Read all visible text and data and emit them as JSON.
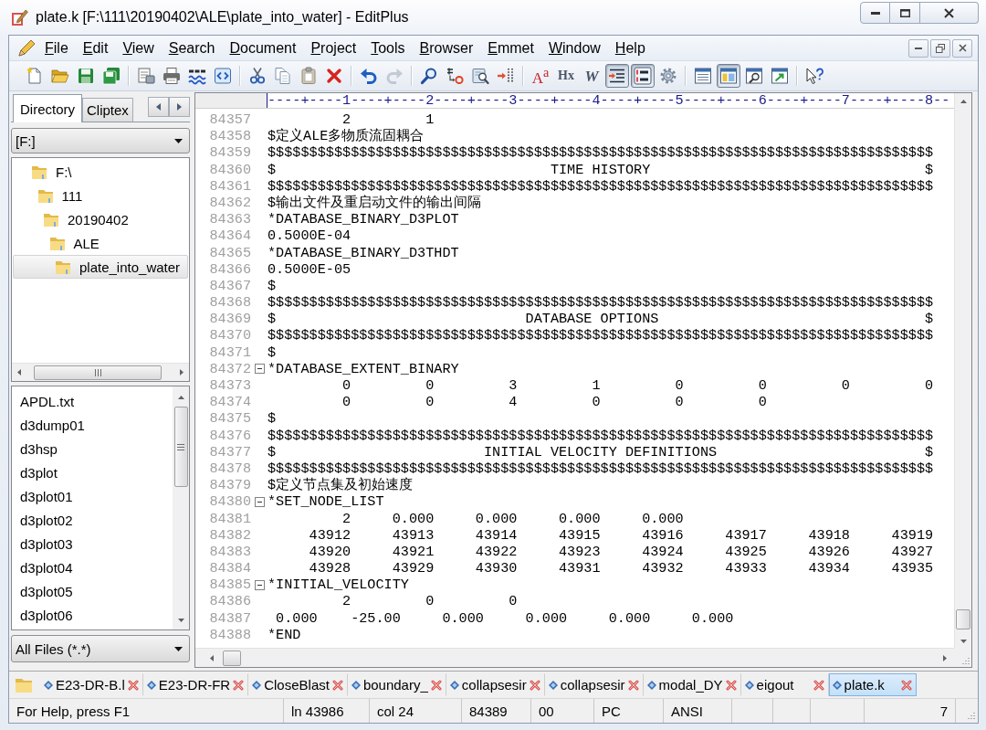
{
  "window": {
    "title": "plate.k [F:\\111\\20190402\\ALE\\plate_into_water] - EditPlus"
  },
  "menu": [
    "File",
    "Edit",
    "View",
    "Search",
    "Document",
    "Project",
    "Tools",
    "Browser",
    "Emmet",
    "Window",
    "Help"
  ],
  "toolbar": [
    [
      {
        "kind": "new",
        "on": false,
        "disabled": false
      },
      {
        "kind": "open",
        "on": false,
        "disabled": false
      },
      {
        "kind": "save",
        "on": false,
        "disabled": false
      },
      {
        "kind": "saveall",
        "on": false,
        "disabled": false
      }
    ],
    [
      {
        "kind": "preview",
        "on": false,
        "disabled": false
      },
      {
        "kind": "print",
        "on": false,
        "disabled": false
      },
      {
        "kind": "spell",
        "on": false,
        "disabled": false
      },
      {
        "kind": "browser",
        "on": false,
        "disabled": false
      }
    ],
    [
      {
        "kind": "cut",
        "on": false,
        "disabled": false
      },
      {
        "kind": "copy",
        "on": false,
        "disabled": false
      },
      {
        "kind": "paste",
        "on": false,
        "disabled": false
      },
      {
        "kind": "delete",
        "on": false,
        "disabled": false
      }
    ],
    [
      {
        "kind": "undo",
        "on": false,
        "disabled": false
      },
      {
        "kind": "redo",
        "on": false,
        "disabled": true
      }
    ],
    [
      {
        "kind": "find",
        "on": false,
        "disabled": false
      },
      {
        "kind": "replace",
        "on": false,
        "disabled": false
      },
      {
        "kind": "findfiles",
        "on": false,
        "disabled": false
      },
      {
        "kind": "goto",
        "on": false,
        "disabled": false
      }
    ],
    [
      {
        "kind": "font",
        "glyph": "A$^{a}$",
        "on": false,
        "disabled": false
      },
      {
        "kind": "hex",
        "glyph": "Hx",
        "on": false,
        "disabled": false
      },
      {
        "kind": "wrap",
        "glyph": "W",
        "on": false,
        "disabled": false
      },
      {
        "kind": "indent",
        "on": true,
        "disabled": false
      },
      {
        "kind": "linenumbers",
        "on": true,
        "disabled": false
      },
      {
        "kind": "settings",
        "on": false,
        "disabled": false
      }
    ],
    [
      {
        "kind": "directory",
        "on": false,
        "disabled": false
      },
      {
        "kind": "output",
        "on": true,
        "disabled": false
      },
      {
        "kind": "cliptext",
        "on": false,
        "disabled": false
      },
      {
        "kind": "fullscreen",
        "on": false,
        "disabled": false
      }
    ],
    [
      {
        "kind": "help",
        "on": false,
        "disabled": false
      }
    ]
  ],
  "sidebar": {
    "tabs": [
      {
        "label": "Directory",
        "selected": true
      },
      {
        "label": "Cliptex",
        "selected": false
      }
    ],
    "drive": "[F:]",
    "tree": [
      {
        "label": "F:\\",
        "selected": false,
        "children": [
          {
            "label": "111",
            "selected": false,
            "children": [
              {
                "label": "20190402",
                "selected": false,
                "children": [
                  {
                    "label": "ALE",
                    "selected": false,
                    "children": [
                      {
                        "label": "plate_into_water",
                        "selected": true
                      }
                    ]
                  }
                ]
              }
            ]
          }
        ]
      }
    ],
    "files": [
      "APDL.txt",
      "d3dump01",
      "d3hsp",
      "d3plot",
      "d3plot01",
      "d3plot02",
      "d3plot03",
      "d3plot04",
      "d3plot05",
      "d3plot06"
    ],
    "filter": "All Files (*.*)"
  },
  "editor": {
    "ruler": "----+----1----+----2----+----3----+----4----+----5----+----6----+----7----+----8--",
    "lines": [
      {
        "number": "84357",
        "text": "         2         1"
      },
      {
        "number": "84358",
        "text": "$定义ALE多物质流固耦合"
      },
      {
        "number": "84359",
        "text": "$$$$$$$$$$$$$$$$$$$$$$$$$$$$$$$$$$$$$$$$$$$$$$$$$$$$$$$$$$$$$$$$$$$$$$$$$$$$$$$$"
      },
      {
        "number": "84360",
        "text": "$                                 TIME HISTORY                                 $"
      },
      {
        "number": "84361",
        "text": "$$$$$$$$$$$$$$$$$$$$$$$$$$$$$$$$$$$$$$$$$$$$$$$$$$$$$$$$$$$$$$$$$$$$$$$$$$$$$$$$"
      },
      {
        "number": "84362",
        "text": "$输出文件及重启动文件的输出间隔"
      },
      {
        "number": "84363",
        "text": "*DATABASE_BINARY_D3PLOT"
      },
      {
        "number": "84364",
        "text": "0.5000E-04"
      },
      {
        "number": "84365",
        "text": "*DATABASE_BINARY_D3THDT"
      },
      {
        "number": "84366",
        "text": "0.5000E-05"
      },
      {
        "number": "84367",
        "text": "$"
      },
      {
        "number": "84368",
        "text": "$$$$$$$$$$$$$$$$$$$$$$$$$$$$$$$$$$$$$$$$$$$$$$$$$$$$$$$$$$$$$$$$$$$$$$$$$$$$$$$$"
      },
      {
        "number": "84369",
        "text": "$                              DATABASE OPTIONS                                $"
      },
      {
        "number": "84370",
        "text": "$$$$$$$$$$$$$$$$$$$$$$$$$$$$$$$$$$$$$$$$$$$$$$$$$$$$$$$$$$$$$$$$$$$$$$$$$$$$$$$$"
      },
      {
        "number": "84371",
        "text": "$"
      },
      {
        "number": "84372",
        "text": "*DATABASE_EXTENT_BINARY",
        "expanded": true
      },
      {
        "number": "84373",
        "text": "         0         0         3         1         0         0         0         0"
      },
      {
        "number": "84374",
        "text": "         0         0         4         0         0         0"
      },
      {
        "number": "84375",
        "text": "$"
      },
      {
        "number": "84376",
        "text": "$$$$$$$$$$$$$$$$$$$$$$$$$$$$$$$$$$$$$$$$$$$$$$$$$$$$$$$$$$$$$$$$$$$$$$$$$$$$$$$$"
      },
      {
        "number": "84377",
        "text": "$                         INITIAL VELOCITY DEFINITIONS                         $"
      },
      {
        "number": "84378",
        "text": "$$$$$$$$$$$$$$$$$$$$$$$$$$$$$$$$$$$$$$$$$$$$$$$$$$$$$$$$$$$$$$$$$$$$$$$$$$$$$$$$"
      },
      {
        "number": "84379",
        "text": "$定义节点集及初始速度"
      },
      {
        "number": "84380",
        "text": "*SET_NODE_LIST",
        "expanded": true
      },
      {
        "number": "84381",
        "text": "         2     0.000     0.000     0.000     0.000"
      },
      {
        "number": "84382",
        "text": "     43912     43913     43914     43915     43916     43917     43918     43919"
      },
      {
        "number": "84383",
        "text": "     43920     43921     43922     43923     43924     43925     43926     43927"
      },
      {
        "number": "84384",
        "text": "     43928     43929     43930     43931     43932     43933     43934     43935"
      },
      {
        "number": "84385",
        "text": "*INITIAL_VELOCITY",
        "expanded": true
      },
      {
        "number": "84386",
        "text": "         2         0         0"
      },
      {
        "number": "84387",
        "text": " 0.000    -25.00     0.000     0.000     0.000     0.000"
      },
      {
        "number": "84388",
        "text": "*END"
      }
    ]
  },
  "file_tabs": [
    {
      "label": "E23-DR-B.l",
      "selected": false
    },
    {
      "label": "E23-DR-FR",
      "selected": false
    },
    {
      "label": "CloseBlast",
      "selected": false
    },
    {
      "label": "boundary_",
      "selected": false
    },
    {
      "label": "collapsesir",
      "selected": false
    },
    {
      "label": "collapsesir",
      "selected": false
    },
    {
      "label": "modal_DY",
      "selected": false
    },
    {
      "label": "eigout",
      "selected": false
    },
    {
      "label": "plate.k",
      "selected": true
    }
  ],
  "status_bar": {
    "cells": [
      "For Help, press F1",
      "ln 43986",
      "col 24",
      "84389",
      "00",
      "PC",
      "ANSI",
      "7"
    ]
  }
}
